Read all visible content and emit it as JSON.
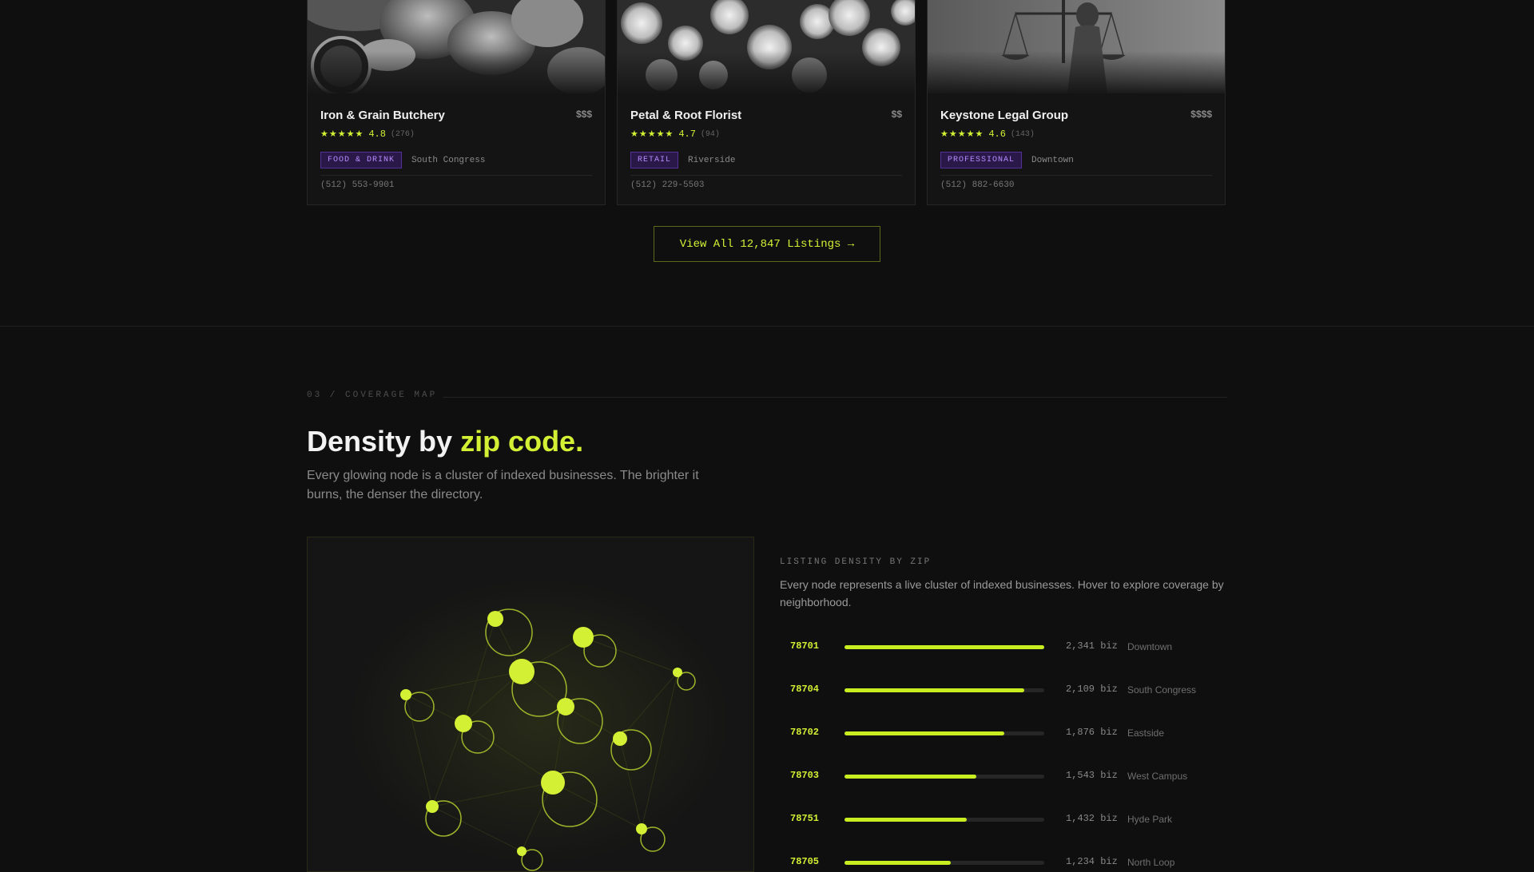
{
  "listings": [
    {
      "name": "Iron & Grain Butchery",
      "price": "$$$",
      "stars": "★★★★★",
      "rating": "4.8",
      "reviews": "(276)",
      "category": "FOOD & DRINK",
      "area": "South Congress",
      "phone": "(512) 553-9901"
    },
    {
      "name": "Petal & Root Florist",
      "price": "$$",
      "stars": "★★★★★",
      "rating": "4.7",
      "reviews": "(94)",
      "category": "RETAIL",
      "area": "Riverside",
      "phone": "(512) 229-5503"
    },
    {
      "name": "Keystone Legal Group",
      "price": "$$$$",
      "stars": "★★★★★",
      "rating": "4.6",
      "reviews": "(143)",
      "category": "PROFESSIONAL",
      "area": "Downtown",
      "phone": "(512) 882-6630"
    }
  ],
  "view_all_label": "View All 12,847 Listings →",
  "coverage": {
    "eyebrow": "03 / COVERAGE MAP",
    "headline_lead": "Density by ",
    "headline_accent": "zip code.",
    "lede": "Every glowing node is a cluster of indexed businesses. The brighter it burns, the denser the directory.",
    "density_title": "LISTING DENSITY BY ZIP",
    "density_desc": "Every node represents a live cluster of indexed businesses. Hover to explore coverage by neighborhood.",
    "zips": [
      {
        "zip": "78701",
        "count": "2,341 biz",
        "area": "Downtown",
        "fill": 1.0
      },
      {
        "zip": "78704",
        "count": "2,109 biz",
        "area": "South Congress",
        "fill": 0.9
      },
      {
        "zip": "78702",
        "count": "1,876 biz",
        "area": "Eastside",
        "fill": 0.8
      },
      {
        "zip": "78703",
        "count": "1,543 biz",
        "area": "West Campus",
        "fill": 0.66
      },
      {
        "zip": "78751",
        "count": "1,432 biz",
        "area": "Hyde Park",
        "fill": 0.61
      },
      {
        "zip": "78705",
        "count": "1,234 biz",
        "area": "North Loop",
        "fill": 0.53
      }
    ]
  },
  "colors": {
    "accent": "#d4f034",
    "background": "#0f0f0f",
    "tag": "#b78cff"
  }
}
